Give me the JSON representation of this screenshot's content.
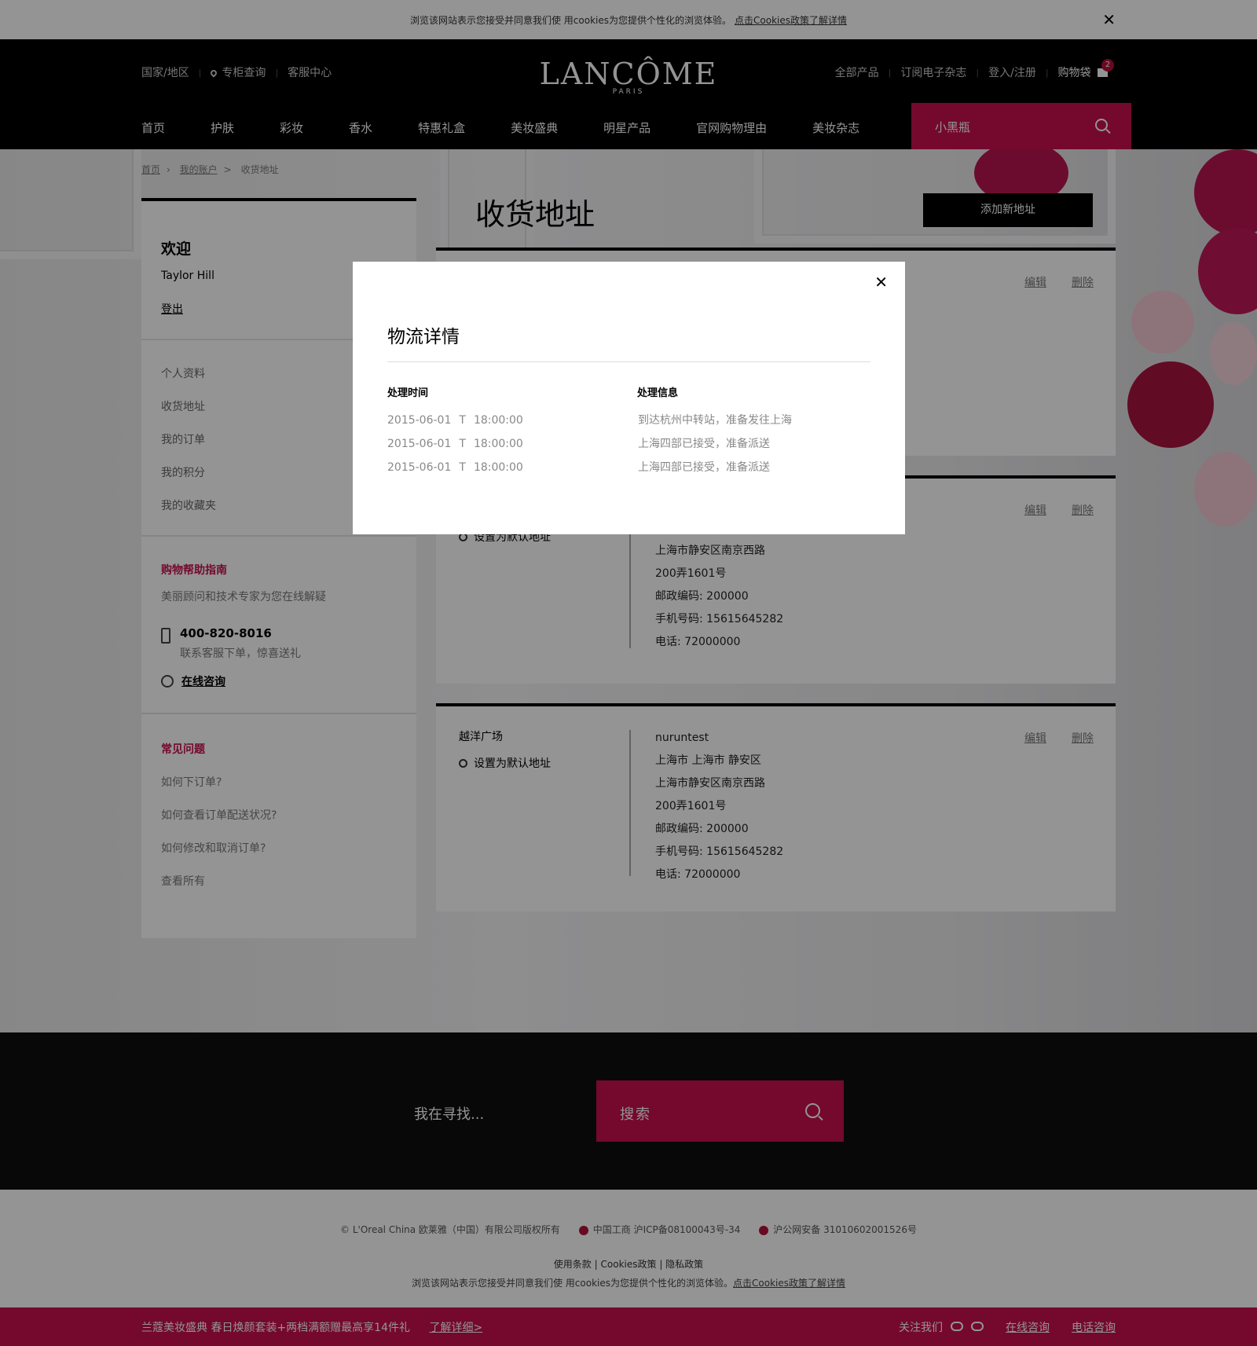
{
  "cookie_bar": {
    "text": "浏览该网站表示您接受并同意我们使 用cookies为您提供个性化的浏览体验。",
    "link": "点击Cookies政策了解详情"
  },
  "header": {
    "top_left": [
      "国家/地区",
      "专柜查询",
      "客服中心"
    ],
    "logo": "LANCÔME",
    "logo_sub": "PARIS",
    "top_right": [
      "全部产品",
      "订阅电子杂志",
      "登入/注册"
    ],
    "bag_label": "购物袋",
    "bag_count": "2",
    "nav": [
      "首页",
      "护肤",
      "彩妆",
      "香水",
      "特惠礼盒",
      "美妆盛典",
      "明星产品",
      "官网购物理由",
      "美妆杂志"
    ],
    "search_placeholder": "小黑瓶"
  },
  "breadcrumb": [
    "首页",
    "我的账户",
    "收货地址"
  ],
  "breadcrumb_sep": ">",
  "sidebar": {
    "welcome": "欢迎",
    "user": "Taylor Hill",
    "logout": "登出",
    "menu": [
      "个人资料",
      "收货地址",
      "我的订单",
      "我的积分",
      "我的收藏夹"
    ],
    "help_title": "购物帮助指南",
    "help_desc": "美丽顾问和技术专家为您在线解疑",
    "phone": "400-820-8016",
    "phone_sub": "联系客服下单，惊喜送礼",
    "online": "在线咨询",
    "faq_title": "常见问题",
    "faq": [
      "如何下订单?",
      "如何查看订单配送状况?",
      "如何修改和取消订单?",
      "查看所有"
    ]
  },
  "page_title": "收货地址",
  "add_button": "添加新地址",
  "addresses": [
    {
      "label": "",
      "default_label": "",
      "lines": [],
      "edit": "编辑",
      "delete": "删除"
    },
    {
      "label": "",
      "default_label": "设置为默认地址",
      "lines": [
        "上海市静安区南京西路",
        "200弄1601号",
        "邮政编码: 200000",
        "手机号码: 15615645282",
        "电话: 72000000"
      ],
      "edit": "编辑",
      "delete": "删除"
    },
    {
      "label": "越洋广场",
      "default_label": "设置为默认地址",
      "lines": [
        "nuruntest",
        "上海市 上海市 静安区",
        "上海市静安区南京西路",
        "200弄1601号",
        "邮政编码: 200000",
        "手机号码: 15615645282",
        "电话: 72000000"
      ],
      "edit": "编辑",
      "delete": "删除"
    }
  ],
  "modal": {
    "title": "物流详情",
    "col_time": "处理时间",
    "col_info": "处理信息",
    "rows": [
      {
        "date": "2015-06-01",
        "t": "T",
        "time": "18:00:00",
        "info": "到达杭州中转站，准备发往上海"
      },
      {
        "date": "2015-06-01",
        "t": "T",
        "time": "18:00:00",
        "info": "上海四部已接受，准备派送"
      },
      {
        "date": "2015-06-01",
        "t": "T",
        "time": "18:00:00",
        "info": "上海四部已接受，准备派送"
      }
    ]
  },
  "footer": {
    "search_label": "我在寻找...",
    "search_placeholder": "搜索",
    "copyright": "© L'Oreal China 欧莱雅（中国）有限公司版权所有",
    "icp": "中国工商 沪ICP备08100043号-34",
    "police": "沪公网安备 31010602001526号",
    "links": [
      "使用条款",
      "Cookies政策",
      "隐私政策"
    ],
    "cookie_text": "浏览该网站表示您接受并同意我们使 用cookies为您提供个性化的浏览体验。",
    "cookie_link": "点击Cookies政策了解详情"
  },
  "promo": {
    "text": "兰蔻美妆盛典 春日焕颜套装+两档满额赠最高享14件礼",
    "more": "了解详细>",
    "follow": "关注我们",
    "online": "在线咨询",
    "phone": "电话咨询"
  },
  "colors": {
    "accent": "#c8104e",
    "header_bg": "#000000"
  }
}
